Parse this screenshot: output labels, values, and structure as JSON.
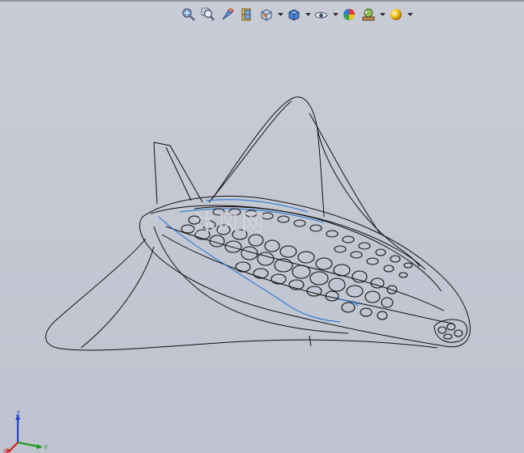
{
  "toolbar": {
    "buttons": [
      {
        "name": "zoom-to-fit-icon",
        "dropdown": false
      },
      {
        "name": "zoom-to-area-icon",
        "dropdown": false
      },
      {
        "name": "previous-view-icon",
        "dropdown": false
      },
      {
        "name": "section-view-icon",
        "dropdown": false
      },
      {
        "name": "view-orientation-icon",
        "dropdown": true
      },
      {
        "name": "display-style-icon",
        "dropdown": true
      },
      {
        "name": "hide-show-items-icon",
        "dropdown": true
      },
      {
        "name": "edit-appearance-icon",
        "dropdown": false
      },
      {
        "name": "apply-scene-icon",
        "dropdown": true
      },
      {
        "name": "view-settings-icon",
        "dropdown": true
      }
    ]
  },
  "watermark": {
    "text": "沐风网"
  },
  "triad": {
    "z_label": "Z",
    "y_label": "Y",
    "x_label": "X"
  },
  "colors": {
    "background": "#c5c8d2",
    "wireframe": "#111111",
    "edge_highlight": "#1a6fd0",
    "triad_z": "#1e3fd6",
    "triad_y": "#1f9b1f",
    "triad_x": "#d11d1d"
  }
}
